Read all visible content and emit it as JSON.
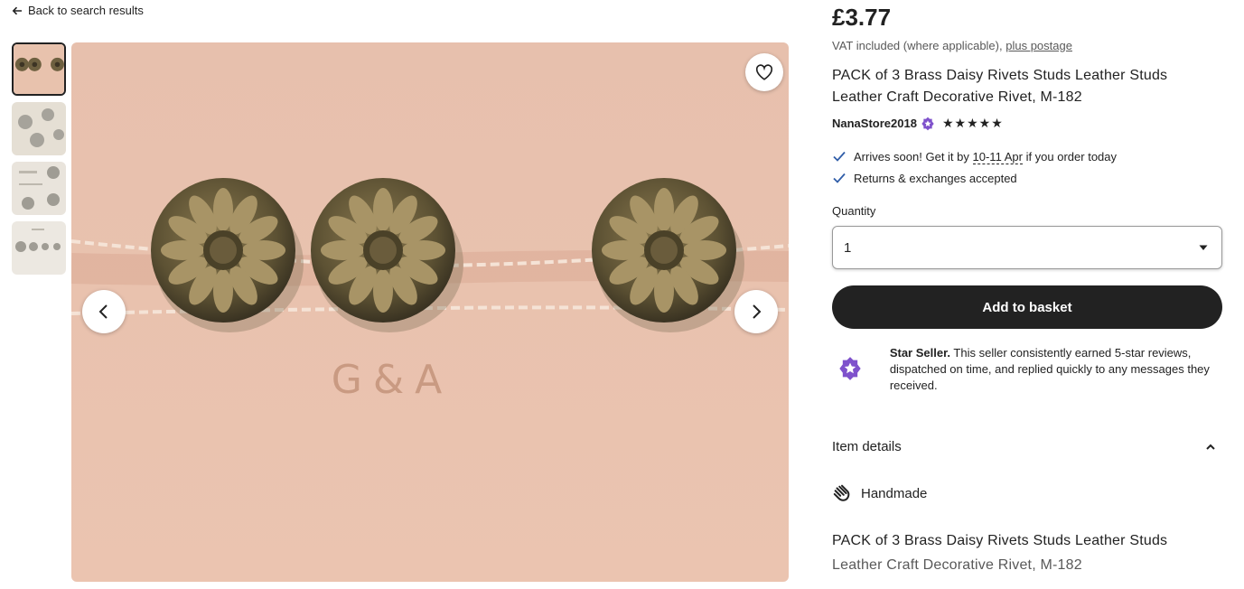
{
  "nav": {
    "back_label": "Back to search results"
  },
  "gallery": {
    "thumbnails": [
      "thumb-1",
      "thumb-2",
      "thumb-3",
      "thumb-4"
    ],
    "main_image_stamp": "G&A"
  },
  "product": {
    "price": "£3.77",
    "vat_text": "VAT included (where applicable),",
    "postage_link": "plus postage",
    "title": "PACK of 3 Brass Daisy Rivets Studs Leather Studs Leather Craft Decorative Rivet, M-182",
    "shop_name": "NanaStore2018",
    "rating_stars": 5
  },
  "perks": {
    "arrives_prefix": "Arrives soon! Get it by",
    "arrives_date": "10-11 Apr",
    "arrives_suffix": "if you order today",
    "returns": "Returns & exchanges accepted"
  },
  "purchase": {
    "quantity_label": "Quantity",
    "quantity_value": "1",
    "add_button": "Add to basket"
  },
  "star_seller": {
    "title": "Star Seller.",
    "text": "This seller consistently earned 5-star reviews, dispatched on time, and replied quickly to any messages they received."
  },
  "details": {
    "header": "Item details",
    "handmade": "Handmade",
    "desc_line1": "PACK of 3 Brass Daisy Rivets Studs Leather Studs",
    "desc_line2": "Leather Craft Decorative Rivet, M-182"
  },
  "colors": {
    "accent_purple": "#7F52CC",
    "button_dark": "#222222",
    "check_blue": "#2F5DA8"
  }
}
